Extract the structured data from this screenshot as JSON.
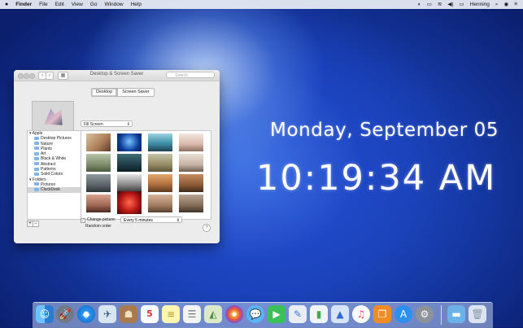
{
  "menubar": {
    "apple": "",
    "app_name": "Finder",
    "items": [
      "File",
      "Edit",
      "View",
      "Go",
      "Window",
      "Help"
    ],
    "right_user": "Henning"
  },
  "window": {
    "title": "Desktop & Screen Saver",
    "search_placeholder": "Search",
    "tabs": [
      "Desktop",
      "Screen Saver"
    ],
    "fill_option": "Fill Screen",
    "sidebar": {
      "group_apple": "Apple",
      "apple_items": [
        "Desktop Pictures",
        "Nature",
        "Plants",
        "Art",
        "Black & White",
        "Abstract",
        "Patterns",
        "Solid Colors"
      ],
      "group_folders": "Folders",
      "folder_items": [
        "Pictures",
        "ClockDesk"
      ]
    },
    "change_picture_label": "Change picture:",
    "interval": "Every 5 minutes",
    "random_order_label": "Random order",
    "add_label": "+",
    "remove_label": "−",
    "help_label": "?"
  },
  "clock": {
    "date": "Monday, September 05",
    "time": "10:19:34 AM"
  },
  "dock": {
    "calendar_day": "5"
  },
  "colors": {
    "accent": "#2a6fe0",
    "background": "#163aa8"
  },
  "icons": [
    "apple-icon",
    "wifi-icon",
    "volume-icon",
    "battery-icon",
    "search-icon",
    "siri-icon",
    "finder-icon",
    "launchpad-icon",
    "safari-icon",
    "trash-icon"
  ]
}
